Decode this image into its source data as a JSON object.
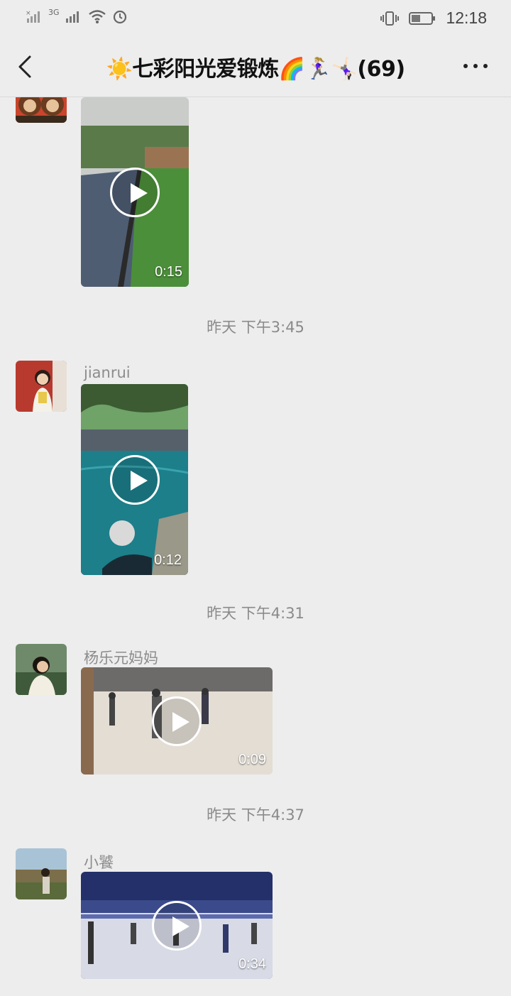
{
  "status_bar": {
    "network_label": "3G",
    "time": "12:18"
  },
  "header": {
    "title": "☀️七彩阳光爱锻炼🌈🏃🏼‍♀️🤸🏻‍♀️(69)",
    "back_icon": "chevron-left-icon",
    "more_icon": "more-dots-icon"
  },
  "messages": [
    {
      "sender": "",
      "video_duration": "0:15"
    },
    {
      "timestamp": "昨天 下午3:45"
    },
    {
      "sender": "jianrui",
      "video_duration": "0:12"
    },
    {
      "timestamp": "昨天 下午4:31"
    },
    {
      "sender": "杨乐元妈妈",
      "video_duration": "0:09"
    },
    {
      "timestamp": "昨天 下午4:37"
    },
    {
      "sender": "小饕",
      "video_duration": "0:34"
    }
  ],
  "colors": {
    "background": "#ededed",
    "timestamp_text": "#8a8a8a",
    "sender_text": "#8c8c8c"
  }
}
